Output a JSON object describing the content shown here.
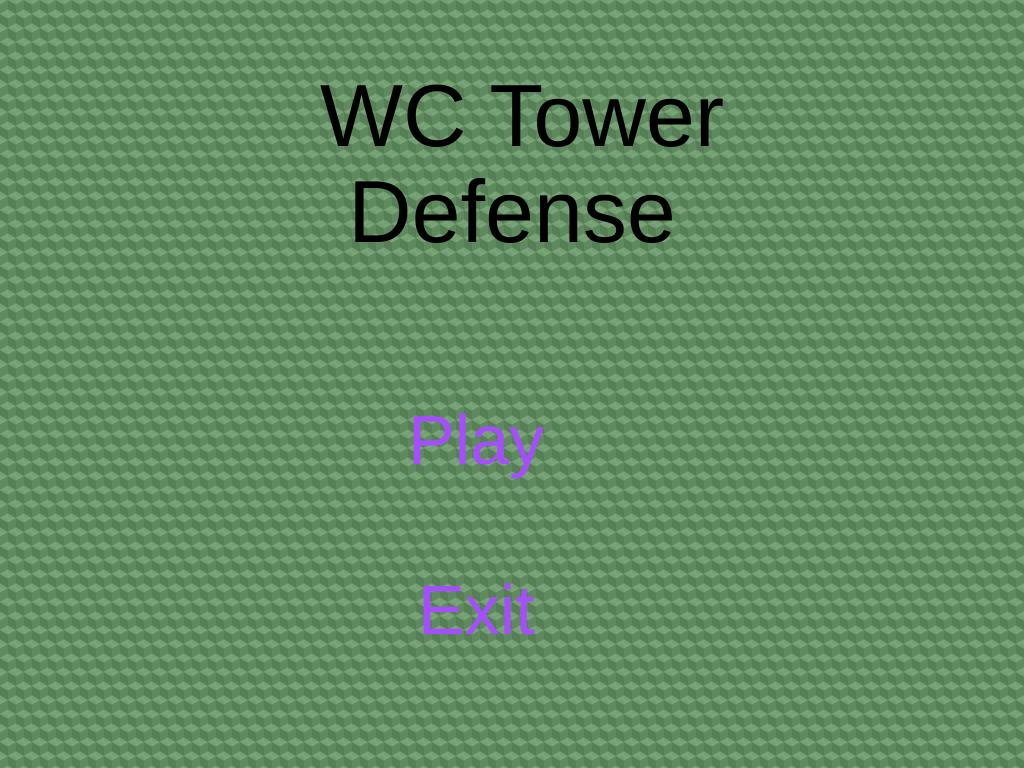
{
  "title": {
    "line1": "WC Tower",
    "line2": "Defense"
  },
  "menu": {
    "play_label": "Play",
    "exit_label": "Exit"
  },
  "colors": {
    "background": "#5f8a5f",
    "title_text": "#000000",
    "menu_text": "#a64dff"
  }
}
